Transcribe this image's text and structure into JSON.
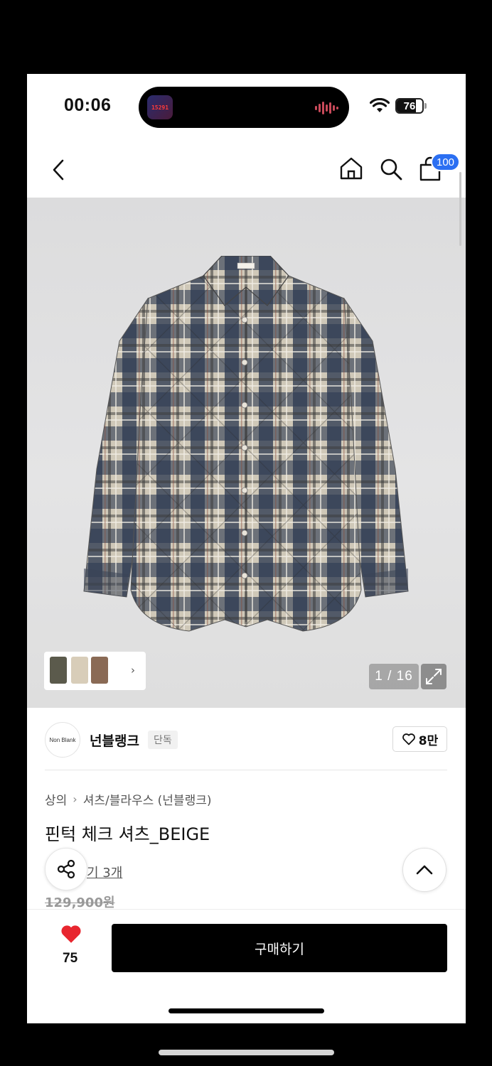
{
  "status_bar": {
    "time": "00:06",
    "island_app_text": "15291",
    "battery_level": 76,
    "battery_label": "76"
  },
  "nav": {
    "back_icon": "chevron-left-icon",
    "home_icon": "home-icon",
    "search_icon": "search-icon",
    "cart_icon": "shopping-bag-icon",
    "cart_count": "100"
  },
  "gallery": {
    "counter": "1 / 16",
    "expand_icon": "expand-icon",
    "thumbnail_colors": [
      "#5b5a4c",
      "#d8cdb9",
      "#8a6a55"
    ]
  },
  "brand": {
    "logo_text": "Non Blank",
    "name": "넌블랭크",
    "tag": "단독",
    "likes": "8만"
  },
  "product": {
    "breadcrumb": [
      "상의",
      "셔츠/블라우스 (넌블랭크)"
    ],
    "title": "핀턱 체크 셔츠_BEIGE",
    "reviews": "기 3개",
    "original_price": "129,900원"
  },
  "bottom_bar": {
    "wish_count": "75",
    "buy_label": "구매하기"
  },
  "colors": {
    "accent_blue": "#2b6ff2",
    "heart_red": "#e8262f",
    "button_black": "#000000"
  }
}
